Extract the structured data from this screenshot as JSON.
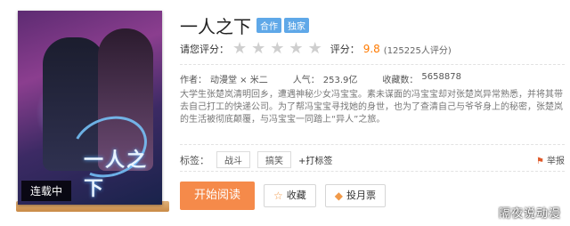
{
  "cover": {
    "status": "连载中",
    "logo": "一人之下"
  },
  "title": "一人之下",
  "badges": [
    "合作",
    "独家"
  ],
  "rating": {
    "label": "请您评分：",
    "score_prefix": "评分：",
    "score": "9.8",
    "count": "(125225人评分)",
    "stars_filled": 0,
    "stars_total": 5
  },
  "meta": {
    "author_label": "作者：",
    "author": "动漫堂 × 米二",
    "popularity_label": "人气：",
    "popularity": "253.9亿",
    "favorites_label": "收藏数：",
    "favorites": "5658878"
  },
  "description": "大学生张楚岚清明回乡，遭遇神秘少女冯宝宝。素未谋面的冯宝宝却对张楚岚异常熟悉，并将其带去自己打工的快递公司。为了帮冯宝宝寻找她的身世，也为了查清自己与爷爷身上的秘密，张楚岚的生活被彻底颠覆，与冯宝宝一同踏上“异人”之旅。",
  "tags": {
    "label": "标签：",
    "items": [
      "战斗",
      "搞笑"
    ],
    "add_label": "+打标签",
    "report_label": "举报"
  },
  "buttons": {
    "read": "开始阅读",
    "favorite": "收藏",
    "monthly_ticket": "投月票"
  },
  "watermark": "隔夜说动漫",
  "colors": {
    "accent": "#f58a4a",
    "score": "#ff7a00",
    "badge": "#5fa8e8"
  }
}
